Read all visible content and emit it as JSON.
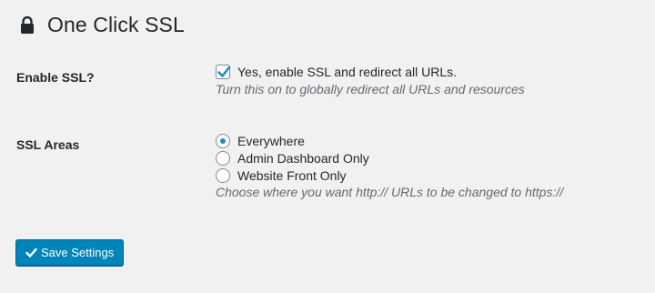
{
  "header": {
    "icon": "lock-icon",
    "title": "One Click SSL"
  },
  "enable_ssl": {
    "label": "Enable SSL?",
    "checkbox_label": "Yes, enable SSL and redirect all URLs.",
    "checked": true,
    "description": "Turn this on to globally redirect all URLs and resources"
  },
  "ssl_areas": {
    "label": "SSL Areas",
    "options": [
      {
        "label": "Everywhere",
        "selected": true
      },
      {
        "label": "Admin Dashboard Only",
        "selected": false
      },
      {
        "label": "Website Front Only",
        "selected": false
      }
    ],
    "description": "Choose where you want http:// URLs to be changed to https://"
  },
  "save_button": {
    "icon": "check-icon",
    "label": "Save Settings"
  },
  "colors": {
    "accent": "#0085ba",
    "background": "#f1f1f1"
  }
}
